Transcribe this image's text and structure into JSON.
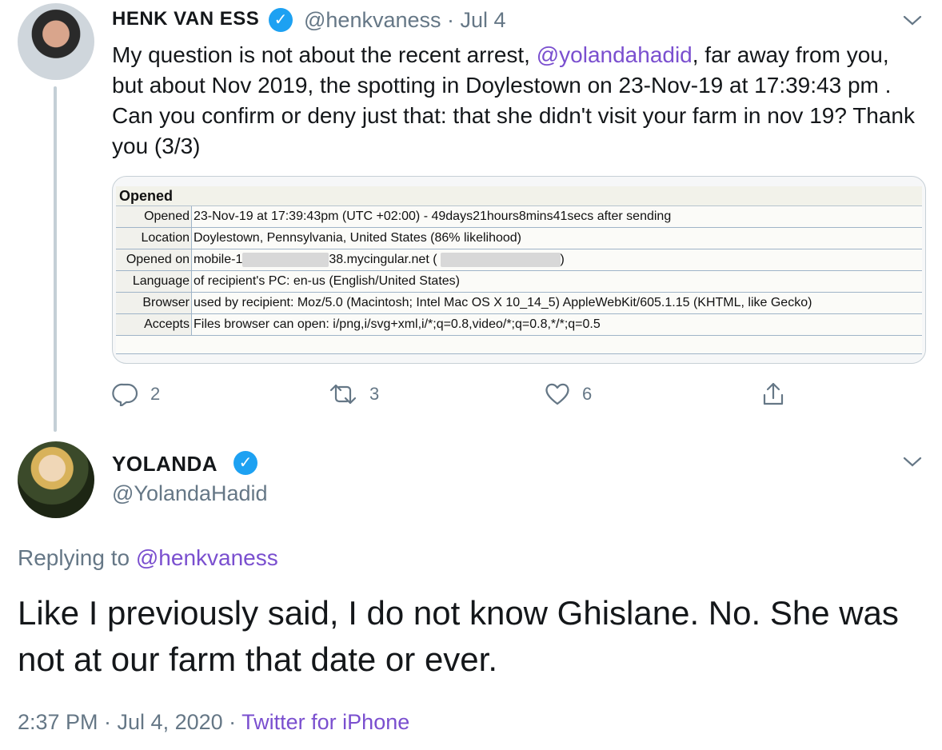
{
  "tweet1": {
    "name": "HENK VAN ESS",
    "handle": "@henkvaness",
    "date": "· Jul 4",
    "text_1": "My question is not about the recent arrest, ",
    "mention": "@yolandahadid",
    "text_2": ", far away from you, but about Nov 2019,  the spotting in Doylestown on  23-Nov-19 at 17:39:43 pm . Can you confirm or deny just that: that she didn't visit your farm in nov 19? Thank you (3/3)",
    "image": {
      "header": "Opened",
      "rows": [
        {
          "key": "Opened",
          "value": "23-Nov-19 at 17:39:43pm (UTC +02:00)  -  49days21hours8mins41secs after sending"
        },
        {
          "key": "Location",
          "value": "Doylestown, Pennsylvania, United States (86% likelihood)"
        },
        {
          "key": "Opened on",
          "value_a": "mobile-1",
          "value_b": "38.mycingular.net (",
          "value_c": ")"
        },
        {
          "key": "Language",
          "value": "of recipient's PC: en-us (English/United States)"
        },
        {
          "key": "Browser",
          "value": "used by recipient: Moz/5.0 (Macintosh; Intel Mac OS X 10_14_5) AppleWebKit/605.1.15 (KHTML, like Gecko)"
        },
        {
          "key": "Accepts",
          "value": "Files browser can open: i/png,i/svg+xml,i/*;q=0.8,video/*;q=0.8,*/*;q=0.5"
        }
      ]
    },
    "actions": {
      "replies": "2",
      "retweets": "3",
      "likes": "6"
    }
  },
  "tweet2": {
    "name": "YOLANDA",
    "handle": "@YolandaHadid",
    "replying_label": "Replying to ",
    "replying_to": "@henkvaness",
    "text": "Like I previously said, I do not know Ghislane. No. She was not at our farm that date or ever.",
    "time": "2:37 PM · Jul 4, 2020 · ",
    "source": "Twitter for iPhone"
  },
  "colors": {
    "accent": "#1da1f2",
    "mention": "#7a4fcf",
    "muted": "#657786"
  },
  "icons": [
    "verified-badge-icon",
    "chevron-down-icon",
    "reply-icon",
    "retweet-icon",
    "like-icon",
    "share-icon"
  ]
}
